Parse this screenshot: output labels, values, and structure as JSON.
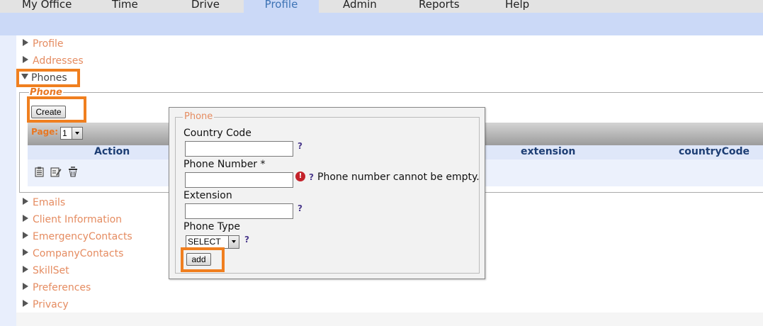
{
  "nav": {
    "tabs": [
      "My Office",
      "Time",
      "Drive",
      "Profile",
      "Admin",
      "Reports",
      "Help"
    ],
    "active": "Profile"
  },
  "accordion": {
    "top_items": [
      "Profile",
      "Addresses",
      "Phones"
    ],
    "bottom_items": [
      "Emails",
      "Client Information",
      "EmergencyContacts",
      "CompanyContacts",
      "SkillSet",
      "Preferences",
      "Privacy"
    ]
  },
  "phones_panel": {
    "legend": "Phone",
    "create_label": "Create",
    "page_label": "Page:",
    "page_value": "1",
    "columns": [
      "Action",
      "extension",
      "countryCode"
    ],
    "row_action_icons": [
      "view-icon",
      "edit-icon",
      "delete-icon"
    ]
  },
  "dialog": {
    "legend": "Phone",
    "fields": {
      "country_code": {
        "label": "Country Code",
        "value": "",
        "help": "?"
      },
      "phone_number": {
        "label": "Phone Number",
        "required_mark": "*",
        "value": "",
        "help": "?",
        "error": "Phone number cannot be empty.",
        "error_icon": "!"
      },
      "extension": {
        "label": "Extension",
        "value": "",
        "help": "?"
      },
      "phone_type": {
        "label": "Phone Type",
        "selected": "SELECT",
        "help": "?"
      }
    },
    "add_label": "add"
  },
  "colors": {
    "accent_orange": "#f07f1f",
    "link_orange": "#e58c61",
    "nav_blue": "#cbd9f7",
    "header_text": "#1d3e74"
  }
}
